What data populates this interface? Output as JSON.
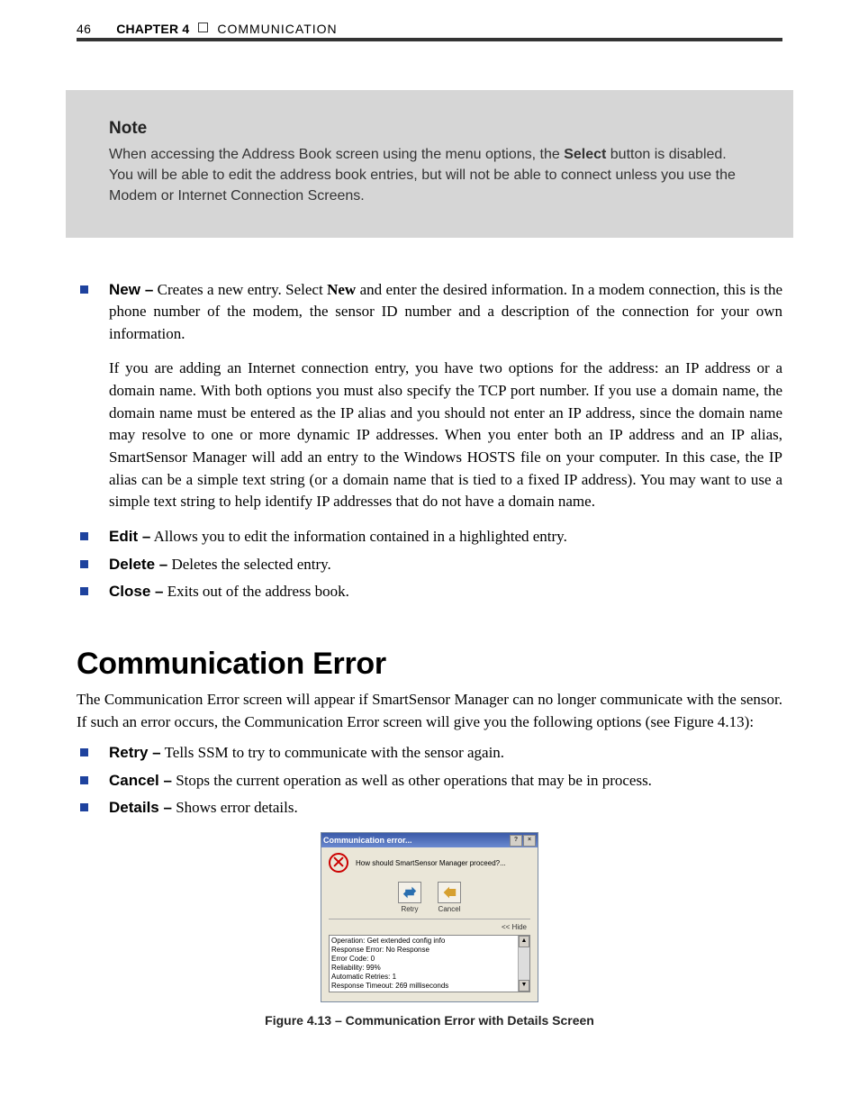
{
  "header": {
    "page_number": "46",
    "chapter_label": "CHAPTER 4",
    "chapter_title": "COMMUNICATION"
  },
  "note": {
    "title": "Note",
    "body_pre": "When accessing the Address Book screen using the menu options, the ",
    "body_bold": "Select",
    "body_post": " button is disabled. You will be able to edit the address book entries, but will not be able to connect unless you use the Modem or Internet Connection Screens."
  },
  "list1": {
    "new": {
      "term": "New –",
      "text_pre": " Creates a new entry. Select ",
      "text_bold": "New",
      "text_post": " and enter the desired information. In a modem connection, this is the phone number of the modem, the sensor ID number and a description of the connection for your own information.",
      "sub": "If you are adding an Internet connection entry, you have two options for the address: an IP address or a domain name. With both options you must also specify the TCP port number. If you use a domain name, the domain name must be entered as the IP alias and you should not  enter an IP address, since the domain name may resolve to one or more dynamic IP addresses. When you enter both an IP address and an IP alias, SmartSensor Manager will add an entry to the Windows HOSTS file on your computer.  In this case, the IP alias can be a simple text string (or a domain name that is tied to a fixed IP address). You may want to use a simple text string to help identify IP addresses that do not have a domain name."
    },
    "edit": {
      "term": "Edit –",
      "text": " Allows you to edit the information contained in a highlighted entry."
    },
    "delete": {
      "term": "Delete –",
      "text": " Deletes the selected entry."
    },
    "close": {
      "term": "Close –",
      "text": " Exits out of the address book."
    }
  },
  "section": {
    "title": "Communication Error",
    "intro": "The Communication Error screen will appear if SmartSensor Manager can no longer communicate with the sensor. If such an error occurs, the Communication Error screen will give you the following options (see Figure 4.13):"
  },
  "list2": {
    "retry": {
      "term": "Retry –",
      "text": " Tells SSM to try to communicate with the sensor again."
    },
    "cancel": {
      "term": "Cancel –",
      "text": " Stops the current operation as well as other operations that may be in process."
    },
    "details": {
      "term": "Details –",
      "text": " Shows error details."
    }
  },
  "dialog": {
    "title": "Communication error...",
    "prompt": "How should SmartSensor Manager proceed?...",
    "retry_label": "Retry",
    "cancel_label": "Cancel",
    "hide_label": "<< Hide",
    "details_lines": [
      "Operation: Get extended config info",
      "Response Error: No Response",
      "Error Code: 0",
      "Reliability: 99%",
      "Automatic Retries: 1",
      "Response Timeout: 269 milliseconds"
    ]
  },
  "figure_caption": "Figure 4.13 – Communication Error with Details Screen"
}
